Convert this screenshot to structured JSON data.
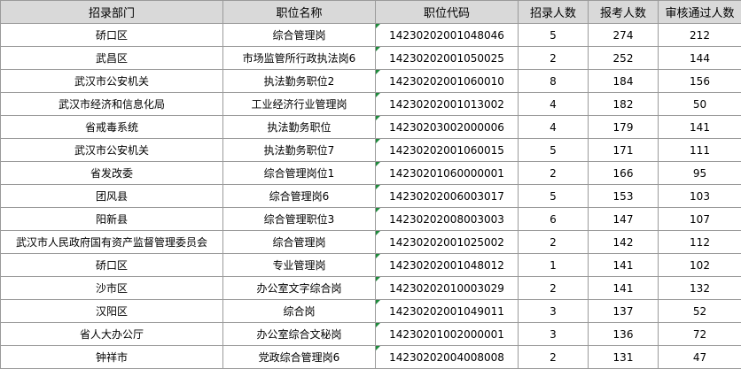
{
  "headers": [
    "招录部门",
    "职位名称",
    "职位代码",
    "招录人数",
    "报考人数",
    "审核通过人数"
  ],
  "rows": [
    [
      "硚口区",
      "综合管理岗",
      "14230202001048046",
      "5",
      "274",
      "212"
    ],
    [
      "武昌区",
      "市场监管所行政执法岗6",
      "14230202001050025",
      "2",
      "252",
      "144"
    ],
    [
      "武汉市公安机关",
      "执法勤务职位2",
      "14230202001060010",
      "8",
      "184",
      "156"
    ],
    [
      "武汉市经济和信息化局",
      "工业经济行业管理岗",
      "14230202001013002",
      "4",
      "182",
      "50"
    ],
    [
      "省戒毒系统",
      "执法勤务职位",
      "14230203002000006",
      "4",
      "179",
      "141"
    ],
    [
      "武汉市公安机关",
      "执法勤务职位7",
      "14230202001060015",
      "5",
      "171",
      "111"
    ],
    [
      "省发改委",
      "综合管理岗位1",
      "14230201060000001",
      "2",
      "166",
      "95"
    ],
    [
      "团风县",
      "综合管理岗6",
      "14230202006003017",
      "5",
      "153",
      "103"
    ],
    [
      "阳新县",
      "综合管理职位3",
      "14230202008003003",
      "6",
      "147",
      "107"
    ],
    [
      "武汉市人民政府国有资产监督管理委员会",
      "综合管理岗",
      "14230202001025002",
      "2",
      "142",
      "112"
    ],
    [
      "硚口区",
      "专业管理岗",
      "14230202001048012",
      "1",
      "141",
      "102"
    ],
    [
      "沙市区",
      "办公室文字综合岗",
      "14230202010003029",
      "2",
      "141",
      "132"
    ],
    [
      "汉阳区",
      "综合岗",
      "14230202001049011",
      "3",
      "137",
      "52"
    ],
    [
      "省人大办公厅",
      "办公室综合文秘岗",
      "14230201002000001",
      "3",
      "136",
      "72"
    ],
    [
      "钟祥市",
      "党政综合管理岗6",
      "14230202004008008",
      "2",
      "131",
      "47"
    ]
  ],
  "colors": {
    "header_bg": "#d9d9d9",
    "grid": "#9a9a9a",
    "text_cell_marker": "#1e8a3c"
  }
}
